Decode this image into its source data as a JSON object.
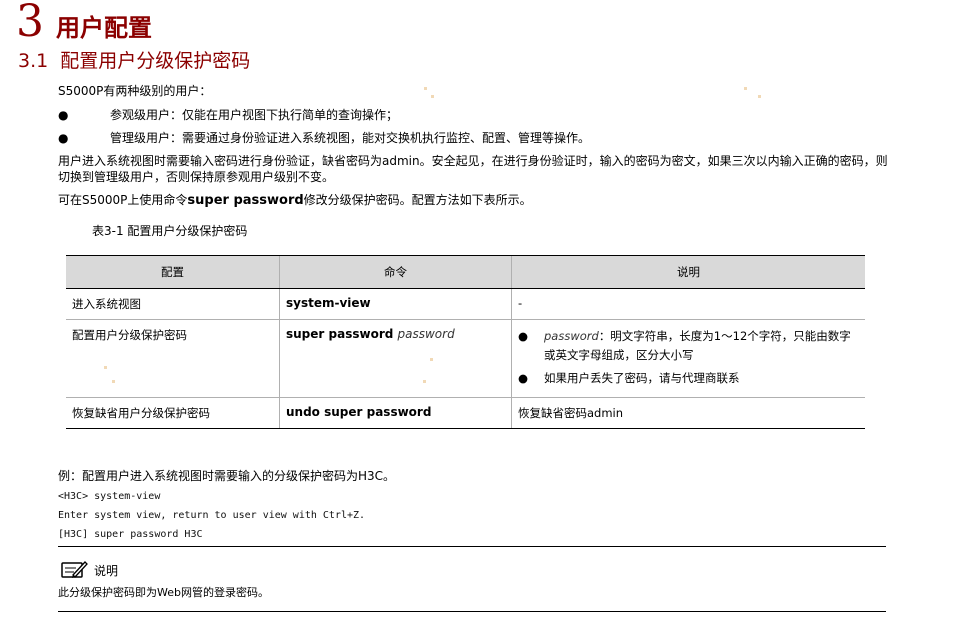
{
  "chapter": {
    "number": "3",
    "title": "用户配置"
  },
  "section": {
    "number": "3.1",
    "title": "配置用户分级保护密码"
  },
  "intro": "S5000P有两种级别的用户：",
  "bullets": [
    "参观级用户：仅能在用户视图下执行简单的查询操作；",
    "管理级用户：需要通过身份验证进入系统视图，能对交换机执行监控、配置、管理等操作。"
  ],
  "para1": "用户进入系统视图时需要输入密码进行身份验证，缺省密码为admin。安全起见，在进行身份验证时，输入的密码为密文，如果三次以内输入正确的密码，则切换到管理级用户，否则保持原参观用户级别不变。",
  "para2": {
    "prefix": "可在S5000P上使用命令",
    "command": "super password",
    "suffix": "修改分级保护密码。配置方法如下表所示。"
  },
  "table": {
    "caption": "表3-1 配置用户分级保护密码",
    "headers": [
      "配置",
      "命令",
      "说明"
    ],
    "rows": [
      {
        "config": "进入系统视图",
        "command": "system-view",
        "arg": "",
        "desc": "-"
      },
      {
        "config": "配置用户分级保护密码",
        "command": "super password",
        "arg": "password",
        "notes": [
          {
            "arg": "password",
            "text": "：明文字符串，长度为1～12个字符，只能由数字或英文字母组成，区分大小写"
          },
          {
            "arg": "",
            "text": "如果用户丢失了密码，请与代理商联系"
          }
        ]
      },
      {
        "config": "恢复缺省用户分级保护密码",
        "command": "undo super password",
        "arg": "",
        "desc": "恢复缺省密码admin"
      }
    ]
  },
  "example": {
    "title": "例：配置用户进入系统视图时需要输入的分级保护密码为H3C。",
    "code": [
      "<H3C> system-view",
      "Enter system view, return to user view with Ctrl+Z.",
      "[H3C] super password H3C"
    ]
  },
  "note": {
    "label": "说明",
    "text": "此分级保护密码即为Web网管的登录密码。",
    "icon": "note-pen-icon"
  },
  "colors": {
    "heading": "#8b0000",
    "table_header_bg": "#d9d9d9"
  }
}
